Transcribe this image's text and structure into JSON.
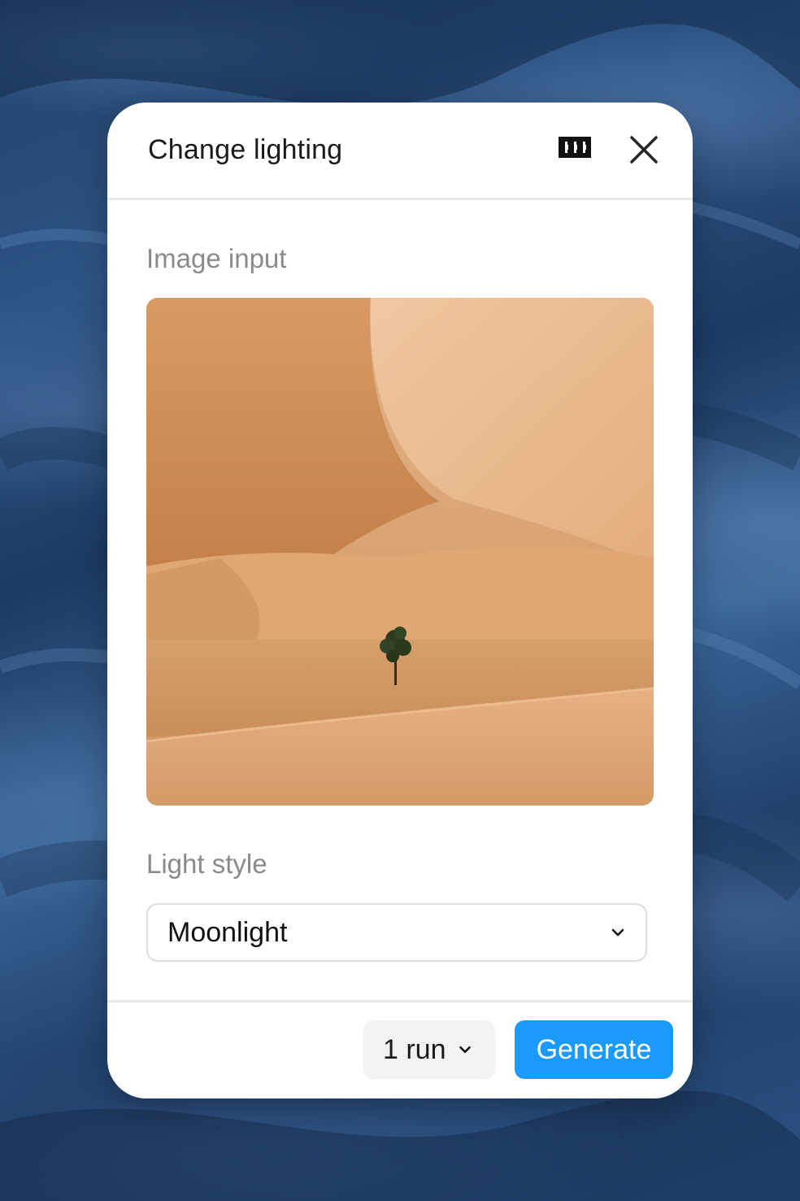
{
  "dialog": {
    "title": "Change lighting",
    "logo_icon": "w-logo-icon",
    "close_icon": "close-icon"
  },
  "image_input": {
    "label": "Image input",
    "image_subject": "desert-dune-with-lone-tree"
  },
  "light_style": {
    "label": "Light style",
    "selected": "Moonlight",
    "chevron_icon": "chevron-down-icon"
  },
  "footer": {
    "runs_label": "1 run",
    "runs_chevron_icon": "chevron-down-icon",
    "generate_label": "Generate"
  },
  "colors": {
    "accent": "#1a9bfc",
    "background": "#2a4f7e",
    "sand": "#d9a473"
  }
}
